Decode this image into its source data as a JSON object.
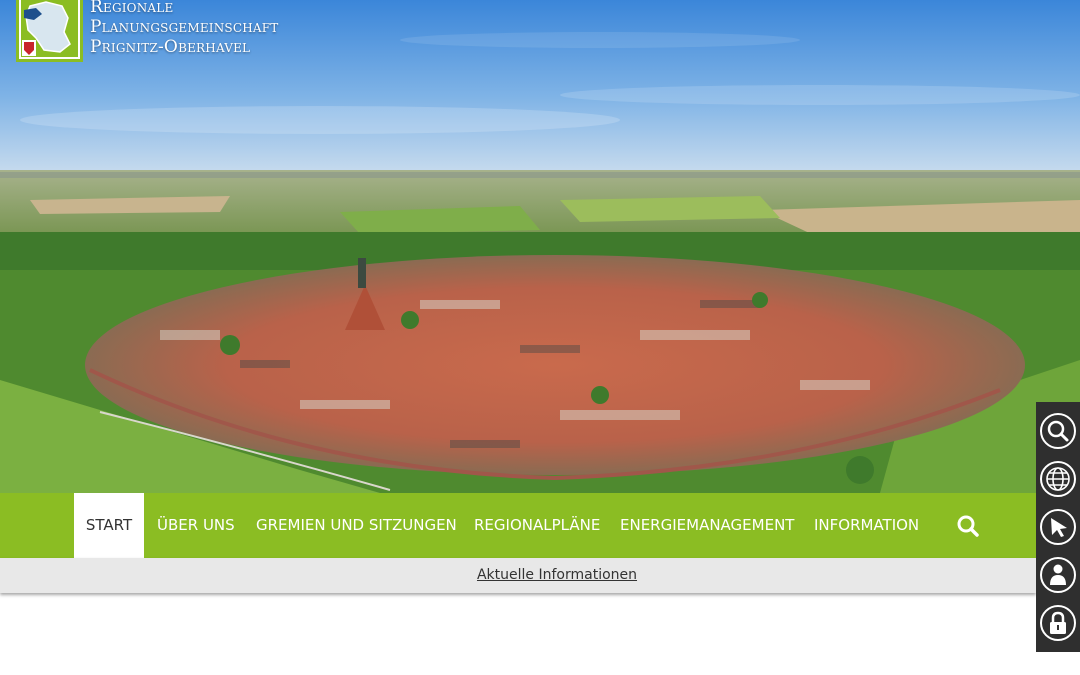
{
  "logo": {
    "line1": "Regionale",
    "line2": "Planungsgemeinschaft",
    "line3": "Prignitz-Oberhavel"
  },
  "hero": {
    "image": "aerial-view-of-historic-town"
  },
  "nav": {
    "items": [
      {
        "label": "START",
        "active": true
      },
      {
        "label": "ÜBER UNS"
      },
      {
        "label": "GREMIEN UND SITZUNGEN"
      },
      {
        "label": "REGIONALPLÄNE"
      },
      {
        "label": "ENERGIEMANAGEMENT"
      },
      {
        "label": "INFORMATION"
      }
    ],
    "search_icon": "search-icon"
  },
  "subbar": {
    "link": "Aktuelle Informationen"
  },
  "sidebar": {
    "buttons": [
      {
        "icon": "search-zoom-icon"
      },
      {
        "icon": "globe-icon"
      },
      {
        "icon": "cursor-pointer-icon"
      },
      {
        "icon": "user-icon"
      },
      {
        "icon": "lock-icon"
      }
    ]
  },
  "colors": {
    "nav_green": "#8bbd23",
    "subbar_gray": "#e8e8e8",
    "sidebar_dark": "#2f2f2f"
  }
}
